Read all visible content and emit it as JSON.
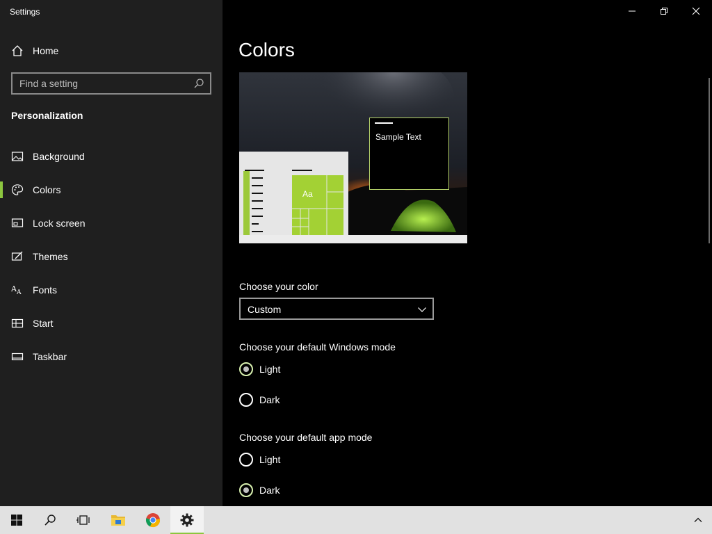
{
  "window": {
    "title": "Settings"
  },
  "sidebar": {
    "home_label": "Home",
    "search_placeholder": "Find a setting",
    "section_title": "Personalization",
    "items": [
      {
        "label": "Background",
        "icon": "picture-icon"
      },
      {
        "label": "Colors",
        "icon": "palette-icon",
        "selected": true
      },
      {
        "label": "Lock screen",
        "icon": "lock-screen-icon"
      },
      {
        "label": "Themes",
        "icon": "themes-icon"
      },
      {
        "label": "Fonts",
        "icon": "fonts-icon"
      },
      {
        "label": "Start",
        "icon": "start-icon"
      },
      {
        "label": "Taskbar",
        "icon": "taskbar-icon"
      }
    ]
  },
  "main": {
    "title": "Colors",
    "preview": {
      "sample_text": "Sample Text",
      "tile_text": "Aa"
    },
    "choose_color": {
      "label": "Choose your color",
      "value": "Custom"
    },
    "windows_mode": {
      "label": "Choose your default Windows mode",
      "options": [
        {
          "label": "Light",
          "checked": true
        },
        {
          "label": "Dark",
          "checked": false
        }
      ]
    },
    "app_mode": {
      "label": "Choose your default app mode",
      "options": [
        {
          "label": "Light",
          "checked": false
        },
        {
          "label": "Dark",
          "checked": true
        }
      ]
    }
  },
  "colors": {
    "accent": "#8cc63f",
    "sidebar_bg": "#1f1f1f",
    "content_bg": "#000000",
    "taskbar_bg": "#e1e1e1"
  },
  "taskbar": {
    "items": [
      "windows-start-icon",
      "search-icon",
      "task-view-icon",
      "file-explorer-icon",
      "chrome-icon",
      "settings-icon"
    ]
  }
}
